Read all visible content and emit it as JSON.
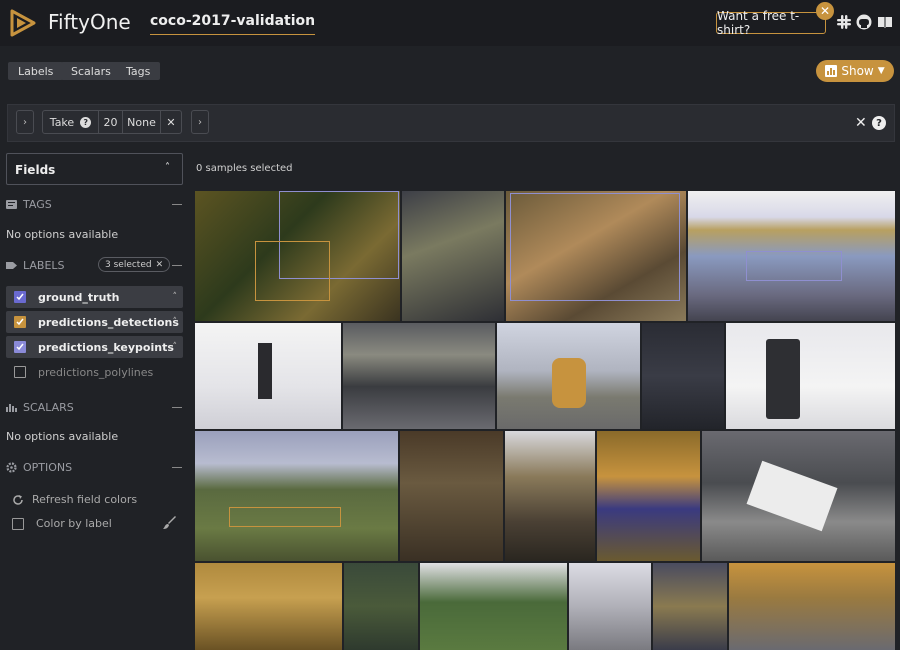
{
  "header": {
    "app_name": "FiftyOne",
    "dataset_name": "coco-2017-validation",
    "promo": "Want a free t-shirt?",
    "icons": [
      "slack-icon",
      "github-icon",
      "docs-icon"
    ]
  },
  "tabs": [
    {
      "label": "Labels"
    },
    {
      "label": "Scalars"
    },
    {
      "label": "Tags"
    }
  ],
  "show_button": {
    "label": "Show"
  },
  "view_bar": {
    "stage_name": "Take",
    "stage_value": "20",
    "stage_seed": "None"
  },
  "sidebar": {
    "fields_label": "Fields",
    "tags": {
      "title": "TAGS",
      "empty": "No options available"
    },
    "labels": {
      "title": "LABELS",
      "badge": "3 selected",
      "items": [
        {
          "label": "ground_truth",
          "checked": true,
          "color": "#6a6ad0"
        },
        {
          "label": "predictions_detections",
          "checked": true,
          "color": "#c7933e"
        },
        {
          "label": "predictions_keypoints",
          "checked": true,
          "color": "#8a8ad8"
        },
        {
          "label": "predictions_polylines",
          "checked": false,
          "color": "#777777"
        }
      ]
    },
    "scalars": {
      "title": "SCALARS",
      "empty": "No options available"
    },
    "options": {
      "title": "OPTIONS",
      "refresh": "Refresh field colors",
      "color_by_label": "Color by label"
    }
  },
  "main": {
    "selection_text": "0 samples selected"
  },
  "colors": {
    "accent": "#c7933e",
    "background": "#202226",
    "header": "#1b1c20"
  }
}
